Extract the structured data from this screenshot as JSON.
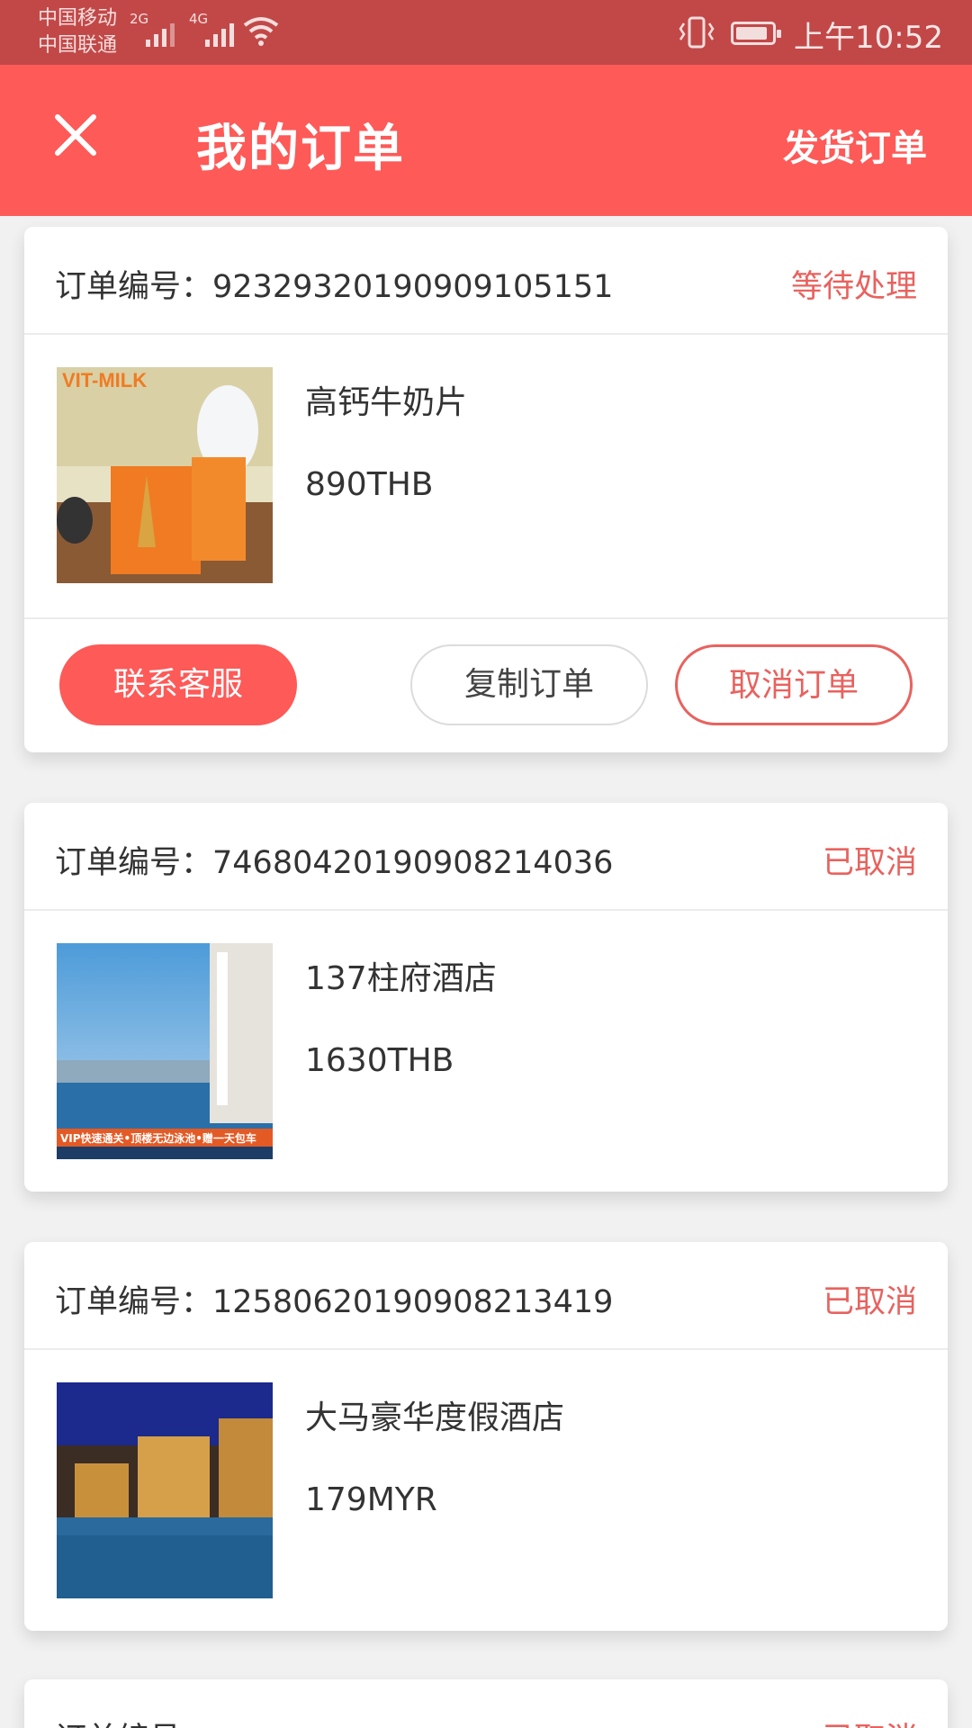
{
  "status_bar": {
    "carrier_1": "中国移动",
    "carrier_2": "中国联通",
    "net_1": "2G",
    "net_2": "4G",
    "time": "上午10:52"
  },
  "header": {
    "title": "我的订单",
    "action_label": "发货订单",
    "close_icon": "close-icon",
    "background": "#fd5a58"
  },
  "order_no_label": "订单编号：",
  "orders": [
    {
      "number": "923293201909091051 51",
      "status": "等待处理",
      "product": "高钙牛奶片",
      "price": "890THB",
      "thumb_text": "VIT-MILK",
      "actions": {
        "contact": "联系客服",
        "copy": "复制订单",
        "cancel": "取消订单"
      }
    },
    {
      "number": "746804201909082140 36",
      "status": "已取消",
      "product": "137柱府酒店",
      "price": "1630THB",
      "thumb_text": "VIP快速通关 • 顶楼无边泳池 • 赠一天包车"
    },
    {
      "number": "125806201909082134 19",
      "status": "已取消",
      "product": "大马豪华度假酒店",
      "price": "179MYR"
    }
  ],
  "partial_order": {
    "label": "订单编号：",
    "status": "已取消"
  },
  "colors": {
    "accent": "#fd5a58",
    "status_text": "#e8625e",
    "statusbar": "#c24848"
  }
}
